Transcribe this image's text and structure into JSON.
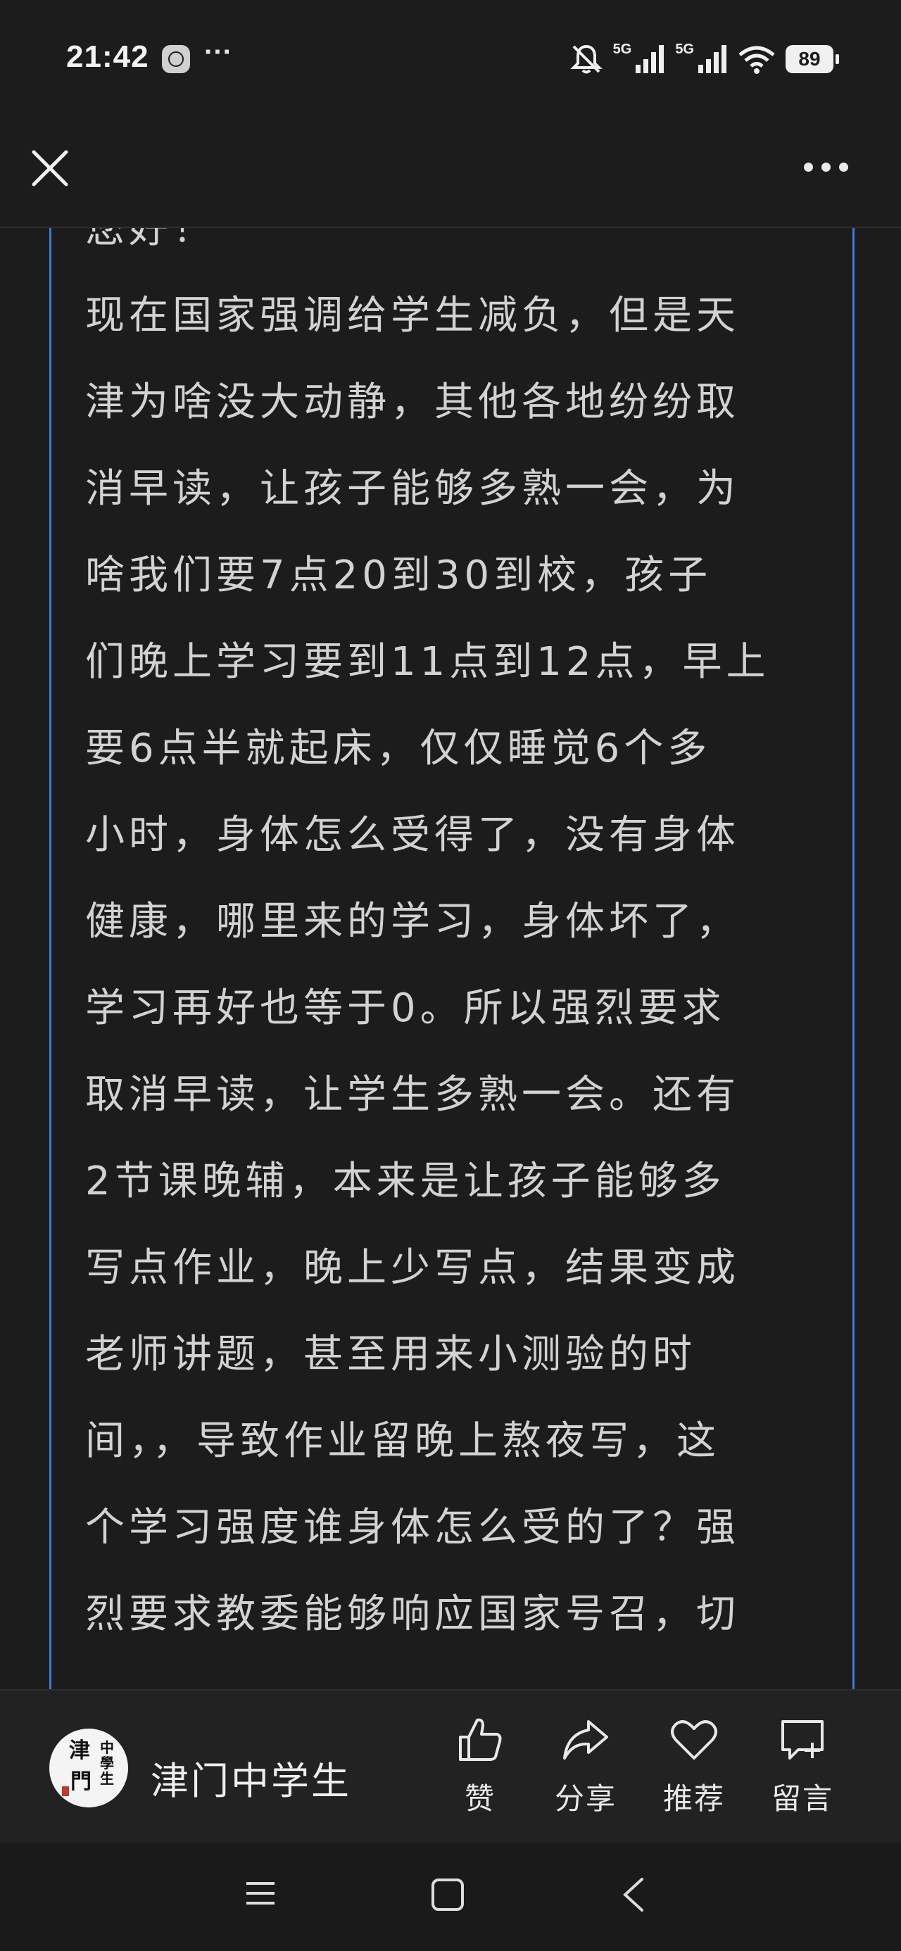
{
  "status_bar": {
    "time": "21:42",
    "more": "···",
    "network_1": "5G",
    "network_2": "5G",
    "battery": "89"
  },
  "nav": {
    "close_icon": "close-icon",
    "more_icon": "more-icon"
  },
  "article": {
    "lines": [
      "您好！",
      "现在国家强调给学生减负，但是天",
      "津为啥没大动静，其他各地纷纷取",
      "消早读，让孩子能够多熟一会，为",
      "啥我们要7点20到30到校，孩子",
      "们晚上学习要到11点到12点，早上",
      "要6点半就起床，仅仅睡觉6个多",
      "小时，身体怎么受得了，没有身体",
      "健康，哪里来的学习，身体坏了，",
      "学习再好也等于0。所以强烈要求",
      "取消早读，让学生多熟一会。还有",
      "2节课晚辅，本来是让孩子能够多",
      "写点作业，晚上少写点，结果变成",
      "老师讲题，甚至用来小测验的时",
      "间，，导致作业留晚上熬夜写，这",
      "个学习强度谁身体怎么受的了？强",
      "烈要求教委能够响应国家号召，切"
    ]
  },
  "bottom_bar": {
    "account_name": "津门中学生",
    "avatar_text": "津門中學生",
    "actions": [
      {
        "label": "赞",
        "icon": "thumbs-up-icon"
      },
      {
        "label": "分享",
        "icon": "share-icon"
      },
      {
        "label": "推荐",
        "icon": "heart-icon"
      },
      {
        "label": "留言",
        "icon": "comment-icon"
      }
    ]
  },
  "system_nav": {
    "menu_icon": "menu-icon",
    "home_icon": "home-icon",
    "back_icon": "back-icon"
  }
}
